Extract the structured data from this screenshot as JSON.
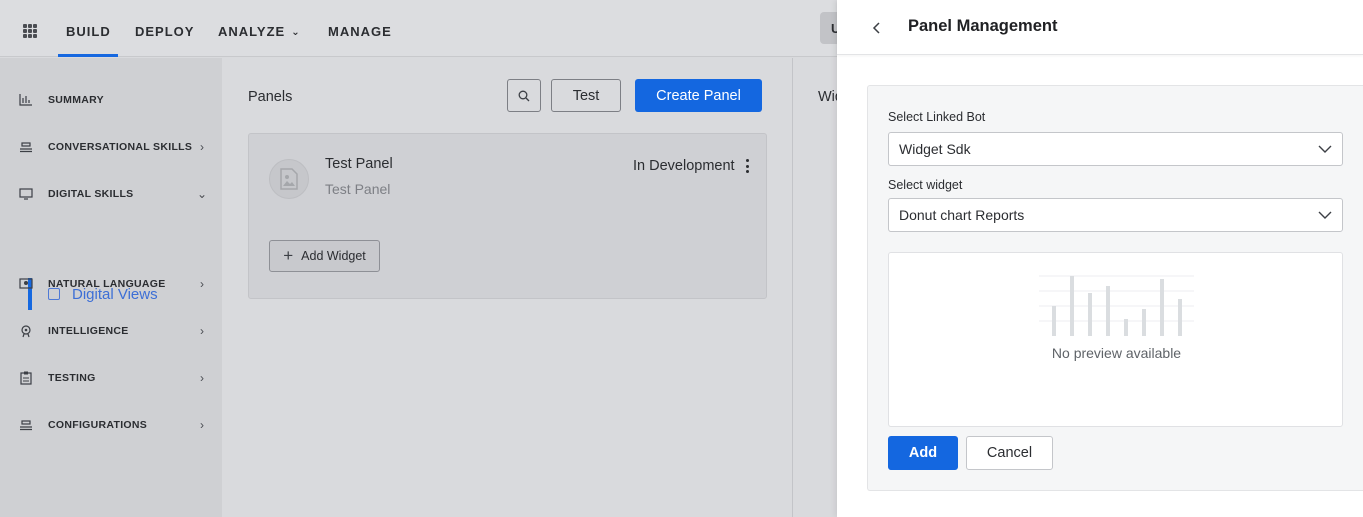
{
  "topnav": {
    "items": [
      "BUILD",
      "DEPLOY",
      "ANALYZE",
      "MANAGE"
    ],
    "user_initial": "U",
    "accent": "#1668e0"
  },
  "sidebar": {
    "items": [
      {
        "label": "SUMMARY",
        "icon": "bar-chart-icon"
      },
      {
        "label": "CONVERSATIONAL SKILLS",
        "icon": "stack-icon"
      },
      {
        "label": "DIGITAL SKILLS",
        "icon": "monitor-icon",
        "expanded": true
      },
      {
        "label": "NATURAL LANGUAGE",
        "icon": "language-icon"
      },
      {
        "label": "INTELLIGENCE",
        "icon": "brain-icon"
      },
      {
        "label": "TESTING",
        "icon": "clipboard-icon"
      },
      {
        "label": "CONFIGURATIONS",
        "icon": "stack-icon"
      }
    ],
    "sub_item": {
      "label": "Digital Views",
      "icon": "view-icon"
    }
  },
  "main": {
    "title": "Panels",
    "test_button": "Test",
    "create_button": "Create Panel",
    "panel": {
      "title": "Test Panel",
      "subtitle": "Test Panel",
      "status": "In Development",
      "add_widget": "Add Widget"
    },
    "right_label": "Wid"
  },
  "drawer": {
    "title": "Panel Management",
    "linked_bot_label": "Select Linked Bot",
    "linked_bot_value": "Widget Sdk",
    "widget_label": "Select widget",
    "widget_value": "Donut chart Reports",
    "preview_text": "No preview available",
    "add_button": "Add",
    "cancel_button": "Cancel"
  }
}
